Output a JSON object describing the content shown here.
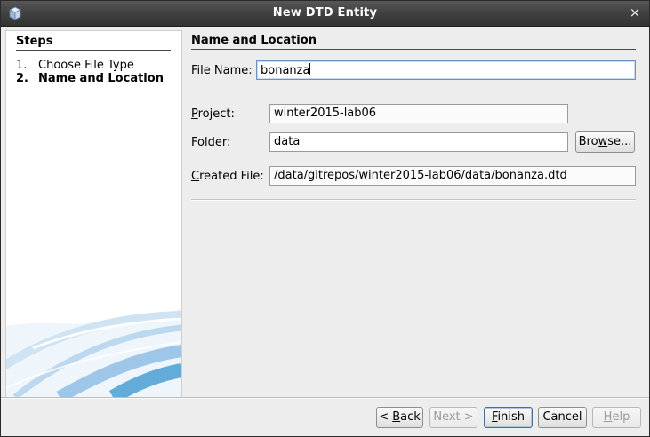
{
  "window": {
    "title": "New DTD Entity",
    "close_glyph": "×",
    "icon": "cube-icon"
  },
  "steps": {
    "heading": "Steps",
    "items": [
      {
        "num": "1.",
        "label": "Choose File Type",
        "current": false
      },
      {
        "num": "2.",
        "label": "Name and Location",
        "current": true
      }
    ]
  },
  "form": {
    "section_title": "Name and Location",
    "file_name": {
      "label_pre": "File ",
      "mnemonic": "N",
      "label_post": "ame:",
      "value": "bonanza"
    },
    "project": {
      "label_pre": "",
      "mnemonic": "P",
      "label_post": "roject:",
      "value": "winter2015-lab06"
    },
    "folder": {
      "label_pre": "Fo",
      "mnemonic": "l",
      "label_post": "der:",
      "value": "data"
    },
    "browse": {
      "label_pre": "Bro",
      "mnemonic": "w",
      "label_post": "se..."
    },
    "created_file": {
      "label_pre": "",
      "mnemonic": "C",
      "label_post": "reated File:",
      "value": "/data/gitrepos/winter2015-lab06/data/bonanza.dtd"
    }
  },
  "buttons": {
    "back": {
      "pre": "< ",
      "mnemonic": "B",
      "post": "ack",
      "enabled": true
    },
    "next": {
      "pre": "Next >",
      "mnemonic": "",
      "post": "",
      "enabled": false
    },
    "finish": {
      "pre": "",
      "mnemonic": "F",
      "post": "inish",
      "enabled": true,
      "default": true
    },
    "cancel": {
      "pre": "Cancel",
      "mnemonic": "",
      "post": "",
      "enabled": true
    },
    "help": {
      "pre": "",
      "mnemonic": "H",
      "post": "elp",
      "enabled": false
    }
  },
  "colors": {
    "titlebar": "#424242",
    "dialog_bg": "#ededed",
    "focus_border": "#6a92c4",
    "default_button_border": "#4d6e99",
    "wizard_art": "#4a9fd4"
  }
}
